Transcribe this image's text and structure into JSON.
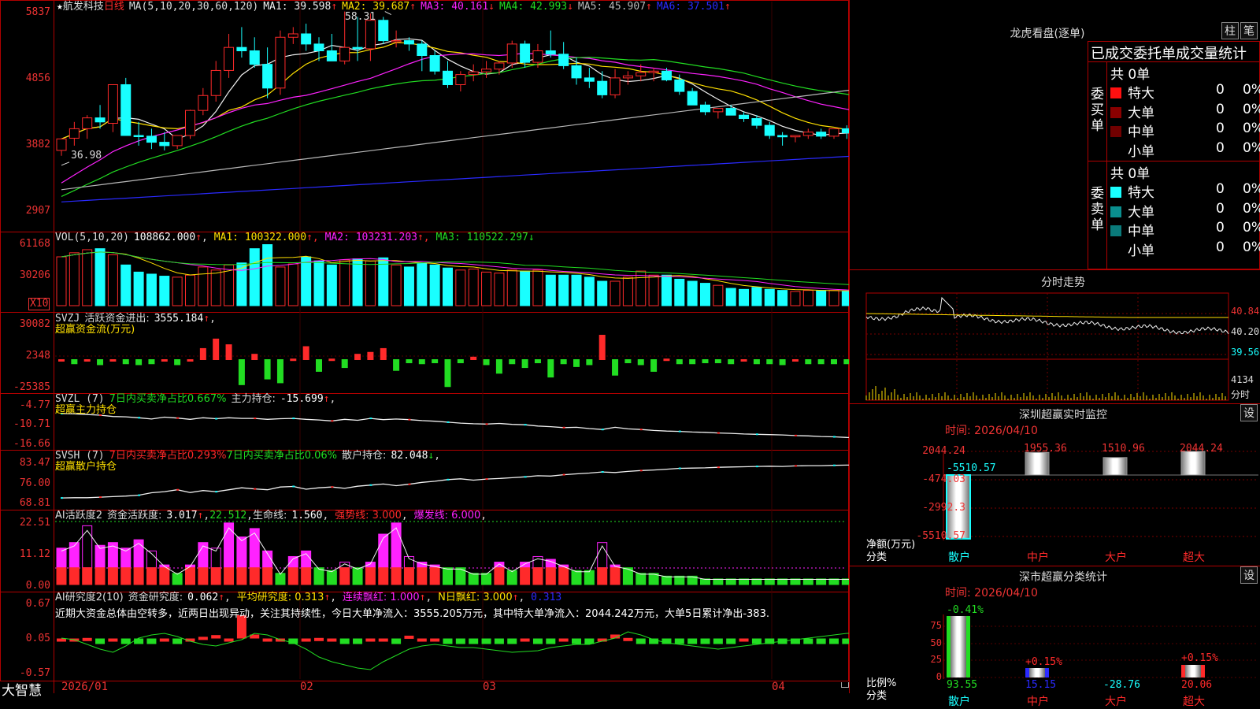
{
  "colors": {
    "up": "#ff2a2a",
    "down": "#19ffff",
    "border": "#b00000",
    "green": "#22dd22",
    "magenta": "#ff22ff",
    "yellow": "#ffe000",
    "white": "#f0f0f0",
    "blue": "#2a2aff",
    "grey": "#b8b8b8"
  },
  "main": {
    "star_icon": "★",
    "stock_name": "航发科技",
    "period": "日线",
    "ma_params": "MA(5,10,20,30,60,120)",
    "ma_labels": [
      {
        "name": "MA1:",
        "value": "39.598",
        "arrow": "↑",
        "color": "#f0f0f0"
      },
      {
        "name": "MA2:",
        "value": "39.687",
        "arrow": "↑",
        "color": "#ffe000"
      },
      {
        "name": "MA3:",
        "value": "40.161",
        "arrow": "↓",
        "color": "#ff22ff"
      },
      {
        "name": "MA4:",
        "value": "42.993",
        "arrow": "↓",
        "color": "#22dd22"
      },
      {
        "name": "MA5:",
        "value": "45.907",
        "arrow": "↑",
        "color": "#b8b8b8"
      },
      {
        "name": "MA6:",
        "value": "37.501",
        "arrow": "↑",
        "color": "#2a2aff"
      }
    ],
    "y_ticks": [
      "5837",
      "4856",
      "3882",
      "2907"
    ],
    "high_label": "58.31",
    "low_label": "36.98"
  },
  "vol": {
    "header_name": "VOL(5,10,20)",
    "header_value": "108862.000",
    "header_arrow": "↑",
    "ma": [
      {
        "name": "MA1:",
        "value": "100322.000",
        "arrow": "↑",
        "color": "#ffe000"
      },
      {
        "name": "MA2:",
        "value": "103231.203",
        "arrow": "↑",
        "color": "#ff22ff"
      },
      {
        "name": "MA3:",
        "value": "110522.297",
        "arrow": "↓",
        "color": "#22dd22"
      }
    ],
    "y_ticks": [
      "61168",
      "30206"
    ],
    "unit": "X10"
  },
  "svzj": {
    "name": "SVZJ",
    "label": "活跃资金进出:",
    "value": "3555.184",
    "arrow": "↑",
    "sub": "超赢资金流(万元)",
    "y_ticks": [
      "30082",
      "2348",
      "-25385"
    ]
  },
  "svzl": {
    "name": "SVZL (7)",
    "label1": "7日内买卖净占比0.667%",
    "label2": "主力持仓:",
    "value": "-15.699",
    "arrow": "↑",
    "sub": "超赢主力持仓",
    "y_ticks": [
      "-4.77",
      "-10.71",
      "-16.66"
    ]
  },
  "svsh": {
    "name": "SVSH (7)",
    "label1": "7日内买卖净占比0.293%",
    "label2": "7日内买卖净占比0.06%",
    "label3": "散户持仓:",
    "value": "82.048",
    "arrow": "↓",
    "sub": "超赢散户持仓",
    "y_ticks": [
      "83.47",
      "76.00",
      "68.81"
    ]
  },
  "ai_act": {
    "name": "AI活跃度2",
    "label": "资金活跃度:",
    "value": "3.017",
    "arrow": "↑",
    "v2": "22.512",
    "life_label": "生命线:",
    "life": "1.560",
    "strong": "强势线: 3.000",
    "burst": "爆发线: 6.000",
    "y_ticks": [
      "22.51",
      "11.12",
      "0.00"
    ]
  },
  "ai_res": {
    "name": "AI研究度2(10)",
    "label": "资金研究度:",
    "value": "0.062",
    "arrow": "↑",
    "avg": "平均研究度: 0.313",
    "streak": "连续飘红: 1.000",
    "nday": "N日飘红: 3.000",
    "last": "0.313",
    "comment": "近期大资金总体由空转多，近两日出现异动，关注其持续性，今日大单净流入：3555.205万元，其中特大单净流入：2044.242万元，大单5日累计净出-383.",
    "y_ticks": [
      "0.67",
      "0.05",
      "-0.57"
    ]
  },
  "x_axis": {
    "labels": [
      "2026/01",
      "02",
      "03",
      "04"
    ],
    "brand": "大智慧"
  },
  "chart_data": [
    {
      "type": "candlestick",
      "title": "航发科技 日线",
      "ylim": [
        29.07,
        58.37
      ],
      "y_ticks": [
        58.37,
        48.56,
        38.82,
        29.07
      ],
      "open": [
        37.8,
        39.6,
        41.0,
        42.6,
        41.8,
        47.5,
        40.0,
        39.9,
        39.0,
        38.5,
        40.0,
        43.7,
        45.9,
        49.6,
        53.0,
        52.5,
        50.5,
        47.0,
        54.5,
        55.0,
        53.5,
        52.5,
        51.0,
        53.0,
        52.8,
        57.0,
        54.0,
        54.0,
        53.5,
        51.8,
        49.5,
        47.5,
        49.0,
        49.4,
        49.8,
        50.7,
        53.5,
        50.8,
        52.5,
        52.0,
        50.3,
        48.5,
        48.0,
        46.0,
        48.5,
        48.8,
        49.3,
        49.5,
        48.2,
        46.5,
        44.5,
        43.5,
        44.0,
        43.0,
        42.5,
        41.5,
        40.0,
        39.8,
        40.0,
        40.5,
        39.9,
        41.0,
        40.4,
        40.3,
        40.8,
        39.3,
        39.2,
        40.7,
        40.1,
        40.0
      ],
      "high": [
        38.8,
        42.0,
        43.0,
        44.5,
        45.5,
        48.5,
        42.0,
        41.0,
        40.5,
        40.0,
        43.8,
        47.0,
        51.0,
        55.0,
        56.0,
        54.5,
        53.0,
        55.5,
        56.0,
        56.5,
        54.5,
        55.0,
        58.3,
        57.5,
        58.0,
        57.5,
        55.5,
        54.5,
        54.0,
        52.5,
        51.0,
        49.5,
        50.5,
        51.0,
        51.0,
        54.0,
        54.0,
        53.5,
        55.5,
        53.8,
        51.5,
        50.0,
        49.5,
        49.8,
        49.5,
        50.5,
        50.0,
        50.0,
        49.0,
        47.0,
        45.0,
        44.0,
        44.5,
        43.5,
        43.0,
        42.0,
        40.5,
        40.0,
        41.0,
        41.0,
        40.5,
        41.5,
        41.2,
        40.8,
        41.0,
        40.5,
        40.0,
        41.0,
        40.8,
        40.8
      ],
      "low": [
        37.0,
        38.5,
        39.5,
        41.0,
        40.5,
        40.0,
        38.5,
        38.0,
        37.8,
        38.0,
        39.5,
        43.0,
        45.0,
        48.5,
        51.5,
        50.0,
        45.5,
        46.0,
        53.5,
        52.5,
        51.0,
        51.0,
        50.5,
        51.0,
        51.0,
        53.5,
        53.0,
        52.5,
        49.5,
        49.0,
        47.0,
        46.5,
        48.0,
        48.5,
        49.0,
        50.0,
        50.0,
        50.0,
        51.5,
        49.8,
        47.5,
        47.0,
        45.5,
        45.5,
        47.5,
        48.0,
        48.0,
        48.0,
        46.0,
        44.5,
        43.0,
        42.5,
        43.0,
        42.0,
        41.0,
        39.5,
        38.5,
        39.0,
        39.5,
        39.5,
        39.5,
        39.5,
        39.7,
        39.7,
        39.8,
        38.8,
        38.8,
        39.8,
        39.8,
        39.9
      ],
      "close": [
        39.5,
        41.0,
        42.6,
        42.0,
        47.5,
        40.0,
        39.9,
        39.0,
        38.5,
        40.0,
        43.7,
        45.9,
        49.6,
        53.0,
        52.5,
        50.5,
        47.0,
        54.5,
        55.0,
        53.5,
        52.5,
        51.0,
        53.0,
        52.8,
        57.0,
        54.0,
        54.0,
        53.5,
        51.8,
        49.5,
        47.5,
        49.0,
        49.4,
        49.8,
        50.7,
        53.5,
        50.8,
        52.5,
        52.0,
        50.3,
        48.5,
        48.0,
        46.0,
        48.5,
        48.8,
        49.3,
        49.5,
        48.2,
        46.5,
        44.5,
        43.5,
        44.0,
        43.0,
        42.5,
        41.5,
        40.0,
        39.8,
        40.0,
        40.5,
        39.9,
        41.0,
        40.4,
        40.3,
        40.8,
        39.3,
        39.2,
        40.7,
        40.1,
        40.0,
        40.9
      ]
    },
    {
      "type": "bar",
      "title": "VOL(5,10,20)",
      "ylim": [
        0,
        61168
      ],
      "y_ticks": [
        61168,
        30206
      ],
      "values": [
        48000,
        52000,
        55000,
        56000,
        50000,
        40000,
        33000,
        31000,
        29000,
        28000,
        30000,
        38000,
        35000,
        40000,
        42000,
        56000,
        60000,
        38000,
        41000,
        48000,
        44000,
        40000,
        45000,
        46000,
        44000,
        47000,
        40000,
        38000,
        42000,
        40000,
        37000,
        35000,
        36000,
        33000,
        32000,
        35000,
        34000,
        35000,
        30000,
        30000,
        30000,
        28000,
        24000,
        24000,
        28000,
        34000,
        30000,
        30000,
        26000,
        24000,
        22000,
        20000,
        17000,
        16000,
        18000,
        16000,
        15000,
        14000,
        15000,
        15000,
        15000,
        14000,
        14000,
        15000,
        15000,
        14000,
        14000,
        14000,
        14000,
        14000
      ]
    },
    {
      "type": "bar",
      "title": "超赢资金流(万元)",
      "ylim": [
        -25385,
        30082
      ],
      "y_ticks": [
        30082,
        2348,
        -25385
      ],
      "values": [
        2000,
        -2000,
        2000,
        -3000,
        2000,
        -2000,
        -3000,
        -2000,
        1000,
        -3000,
        2000,
        14000,
        24000,
        18000,
        -24000,
        8000,
        -18000,
        -22000,
        3000,
        16000,
        -10000,
        3000,
        -6000,
        8000,
        10000,
        14000,
        -9000,
        -1000,
        -2000,
        -1000,
        -26000,
        -1000,
        5000,
        -3000,
        -12000,
        -2000,
        -6000,
        -1000,
        -16000,
        -2000,
        -5000,
        -3000,
        28000,
        -14000,
        -1000,
        -3000,
        -10000,
        3000,
        -2000,
        -2000,
        -1000,
        -1000,
        -2000,
        2000,
        -2000,
        -2000,
        -3000,
        2000,
        -2000,
        -2000,
        -2000,
        -2000,
        -1000,
        -2000,
        -3000,
        -2000,
        -1000,
        1000,
        -3000,
        2000
      ]
    },
    {
      "type": "line",
      "title": "超赢主力持仓",
      "ylim": [
        -16.66,
        -4.77
      ],
      "y_ticks": [
        -4.77,
        -10.71,
        -16.66
      ],
      "values": [
        -7.5,
        -7.6,
        -7.8,
        -8.0,
        -8.4,
        -8.5,
        -8.8,
        -9.2,
        -8.6,
        -8.9,
        -9.3,
        -8.8,
        -9.1,
        -8.8,
        -9.0,
        -9.0,
        -9.3,
        -9.1,
        -9.0,
        -9.3,
        -9.5,
        -9.8,
        -9.3,
        -9.6,
        -9.0,
        -9.4,
        -9.2,
        -9.4,
        -9.7,
        -9.9,
        -10.2,
        -10.5,
        -10.7,
        -10.8,
        -10.6,
        -10.9,
        -11.0,
        -11.4,
        -11.6,
        -11.9,
        -11.8,
        -12.2,
        -12.5,
        -11.8,
        -12.3,
        -12.5,
        -12.8,
        -13.0,
        -13.1,
        -13.3,
        -13.4,
        -13.6,
        -13.7,
        -13.9,
        -14.0,
        -14.1,
        -14.2,
        -14.4,
        -14.5,
        -14.7,
        -14.8,
        -15.0,
        -15.1,
        -15.3,
        -15.5,
        -15.6,
        -15.6,
        -15.5,
        -15.5,
        -15.4
      ]
    },
    {
      "type": "line",
      "title": "超赢散户持仓",
      "ylim": [
        68.81,
        83.47
      ],
      "y_ticks": [
        83.47,
        76.0,
        68.81
      ],
      "values": [
        70.5,
        70.6,
        70.6,
        70.8,
        71.0,
        71.2,
        71.5,
        72.4,
        72.8,
        73.5,
        72.5,
        73.2,
        72.8,
        73.5,
        74.2,
        73.8,
        73.5,
        74.5,
        74.7,
        73.7,
        74.2,
        74.5,
        74.0,
        74.8,
        75.2,
        75.6,
        75.0,
        75.5,
        76.2,
        76.6,
        77.2,
        77.5,
        77.0,
        77.4,
        77.6,
        77.9,
        78.2,
        78.6,
        78.5,
        79.0,
        79.3,
        79.6,
        80.0,
        79.8,
        80.2,
        80.5,
        80.7,
        81.0,
        81.3,
        81.4,
        81.5,
        81.7,
        81.8,
        81.9,
        82.0,
        82.1,
        82.0,
        82.2,
        82.3,
        82.3,
        82.4,
        82.5,
        82.5,
        82.6,
        82.5,
        82.6,
        82.8,
        82.6,
        82.4,
        82.2
      ]
    },
    {
      "type": "bar",
      "title": "AI活跃度2",
      "ylim": [
        0,
        22.51
      ],
      "y_ticks": [
        22.51,
        11.12,
        0.0
      ],
      "values": [
        13,
        15,
        21,
        14,
        15,
        13,
        16,
        12,
        7,
        4,
        7,
        15,
        13,
        22,
        17,
        20,
        12,
        4,
        10,
        12,
        6,
        5,
        8,
        6,
        8,
        18,
        22,
        10,
        8,
        7,
        6,
        6,
        4,
        4,
        8,
        5,
        8,
        10,
        9,
        7,
        5,
        5,
        15,
        7,
        6,
        4,
        4,
        3,
        3,
        3,
        2,
        2,
        2,
        2,
        2,
        2,
        2,
        2,
        2,
        2,
        2,
        2,
        2,
        2,
        2,
        2,
        2,
        2,
        2,
        2
      ]
    },
    {
      "type": "bar",
      "title": "AI研究度2(10)",
      "ylim": [
        -0.57,
        0.67
      ],
      "y_ticks": [
        0.67,
        0.05,
        -0.57
      ],
      "values": [
        0.05,
        0.05,
        0.06,
        0.04,
        0.05,
        0.04,
        -0.08,
        -0.12,
        0.05,
        0.04,
        0.05,
        0.08,
        0.11,
        0.05,
        0.46,
        0.12,
        0.05,
        0.05,
        -0.05,
        0.05,
        0.06,
        0.05,
        -0.05,
        -0.08,
        0.05,
        0.05,
        -0.06,
        0.1,
        0.05,
        0.05,
        -0.05,
        -0.05,
        -0.06,
        -0.05,
        -0.05,
        -0.06,
        0.05,
        -0.05,
        -0.06,
        0.05,
        -0.05,
        -0.05,
        0.05,
        0.12,
        0.06,
        -0.06,
        -0.06,
        -0.08,
        -0.07,
        -0.06,
        -0.06,
        -0.05,
        -0.05,
        0.05,
        -0.05,
        -0.05,
        -0.06,
        -0.06,
        -0.05,
        -0.05,
        -0.06,
        -0.05,
        -0.05,
        -0.05,
        -0.06,
        -0.05,
        -0.06,
        0.05,
        0.05,
        0.06
      ]
    }
  ],
  "right": {
    "lh_title": "龙虎看盘(逐单)",
    "btn1": "柱",
    "btn2": "笔",
    "stat_title": "已成交委托单成交量统计",
    "buy_label": "委买单",
    "sell_label": "委卖单",
    "buy_total": "共 0单",
    "sell_total": "共 0单",
    "rows": [
      "特大",
      "大单",
      "中单",
      "小单"
    ],
    "row_val": "0",
    "row_pct": "0%",
    "buy_colors": [
      "#ff1010",
      "#8a0000",
      "#700000",
      "#000000"
    ],
    "sell_colors": [
      "#19ffff",
      "#0a8f8f",
      "#0a7a7a",
      "#000000"
    ],
    "fs_title": "分时走势",
    "fs_ticks": [
      "40.84",
      "40.20",
      "39.56",
      "4134",
      "分时"
    ],
    "sz_title": "深圳超赢实时监控",
    "sz_btn": "设",
    "sz_time": "时间: 2026/04/10",
    "sz_ticks": [
      "2044.24",
      "-474.03",
      "-2992.3",
      "-5510.57"
    ],
    "sz_values": [
      "-5510.57",
      "1955.36",
      "1510.96",
      "2044.24"
    ],
    "sz_y1": "净额(万元)",
    "sz_y2": "分类",
    "cats": [
      "散户",
      "中户",
      "大户",
      "超大"
    ],
    "ss_title": "深市超赢分类统计",
    "ss_btn": "设",
    "ss_time": "时间: 2026/04/10",
    "ss_ticks": [
      "75",
      "50",
      "25",
      "0"
    ],
    "ss_top": [
      "-0.41%",
      "+0.15%",
      "+0.15%"
    ],
    "ss_bottom": [
      "93.55",
      "15.15",
      "-28.76",
      "20.06"
    ],
    "ss_y1": "比例%",
    "ss_y2": "分类"
  }
}
